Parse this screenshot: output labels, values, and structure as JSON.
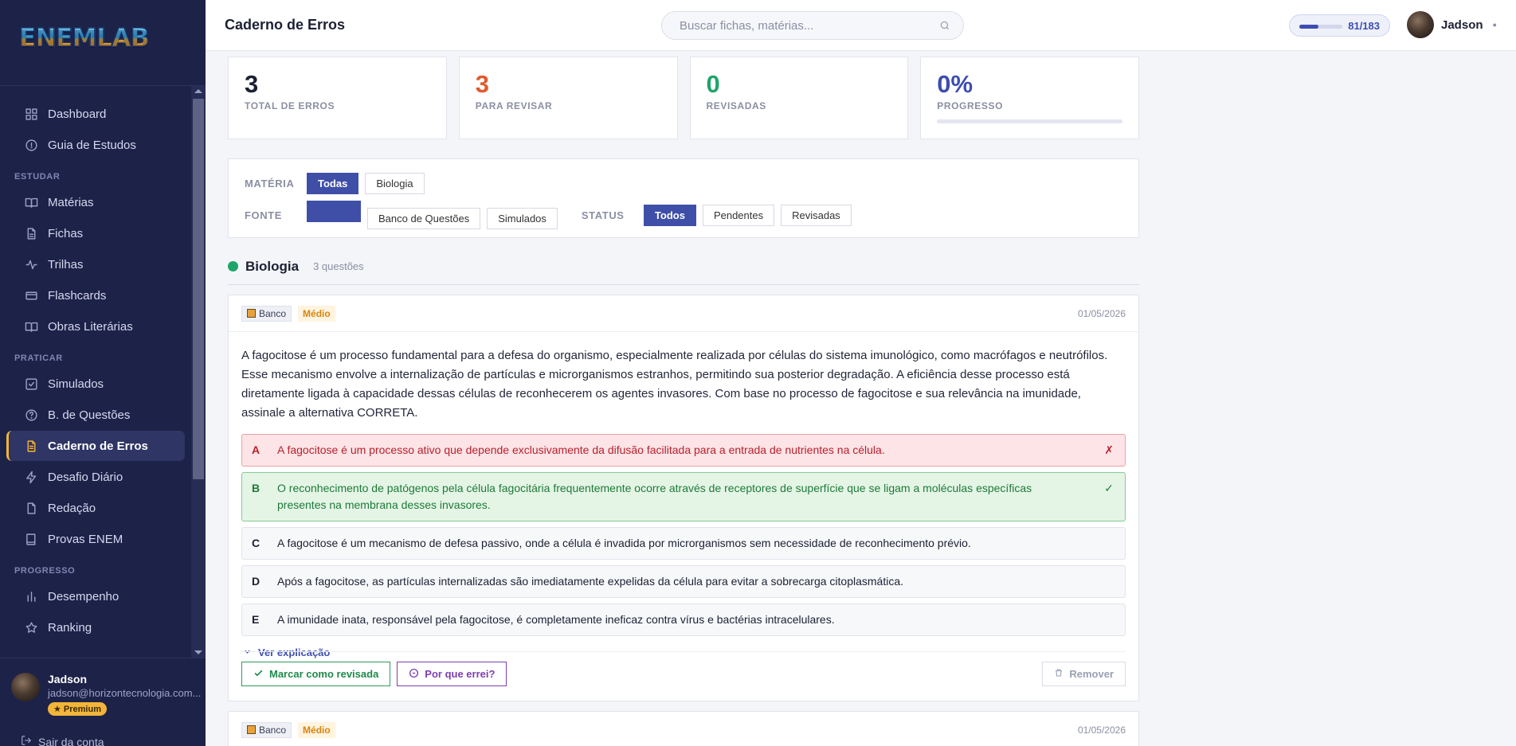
{
  "app": {
    "logo_text": "ENEMLAB"
  },
  "header": {
    "title": "Caderno de Erros",
    "search_placeholder": "Buscar fichas, matérias...",
    "progress_label": "81/183",
    "progress_fraction": 0.4426,
    "user_name": "Jadson"
  },
  "sidebar": {
    "top_items": [
      {
        "label": "Dashboard",
        "icon": "grid-icon"
      },
      {
        "label": "Guia de Estudos",
        "icon": "compass-icon"
      }
    ],
    "sections": [
      {
        "title": "ESTUDAR",
        "items": [
          {
            "label": "Matérias",
            "icon": "book-open-icon"
          },
          {
            "label": "Fichas",
            "icon": "file-text-icon"
          },
          {
            "label": "Trilhas",
            "icon": "activity-icon"
          },
          {
            "label": "Flashcards",
            "icon": "cards-icon"
          },
          {
            "label": "Obras Literárias",
            "icon": "book-icon"
          }
        ]
      },
      {
        "title": "PRATICAR",
        "items": [
          {
            "label": "Simulados",
            "icon": "check-square-icon"
          },
          {
            "label": "B. de Questões",
            "icon": "help-circle-icon"
          },
          {
            "label": "Caderno de Erros",
            "icon": "notebook-icon",
            "active": true
          },
          {
            "label": "Desafio Diário",
            "icon": "zap-icon"
          },
          {
            "label": "Redação",
            "icon": "edit-icon"
          },
          {
            "label": "Provas ENEM",
            "icon": "book-closed-icon"
          }
        ]
      },
      {
        "title": "PROGRESSO",
        "items": [
          {
            "label": "Desempenho",
            "icon": "bar-chart-icon"
          },
          {
            "label": "Ranking",
            "icon": "star-icon"
          }
        ]
      }
    ],
    "user": {
      "name": "Jadson",
      "email": "jadson@horizontecnologia.com...",
      "badge": "★ Premium",
      "logout_label": "Sair da conta"
    }
  },
  "stats": [
    {
      "value": "3",
      "label": "TOTAL DE ERROS",
      "color": "#1c2033"
    },
    {
      "value": "3",
      "label": "PARA REVISAR",
      "color": "#e25a2c"
    },
    {
      "value": "0",
      "label": "REVISADAS",
      "color": "#1fa46a"
    },
    {
      "value": "0%",
      "label": "PROGRESSO",
      "color": "#3d4db0",
      "progress": 0
    }
  ],
  "filters": {
    "materia_label": "MATÉRIA",
    "materia_options": [
      "Todas",
      "Biologia"
    ],
    "materia_selected": "Todas",
    "fonte_label": "FONTE",
    "fonte_options": [
      "",
      "Banco de Questões",
      "Simulados"
    ],
    "fonte_selected": "",
    "status_label": "STATUS",
    "status_options": [
      "Todos",
      "Pendentes",
      "Revisadas"
    ],
    "status_selected": "Todos"
  },
  "group": {
    "name": "Biologia",
    "count": "3 questões",
    "color": "#1fa46a"
  },
  "cards": [
    {
      "source": "Banco",
      "difficulty": "Médio",
      "date": "01/05/2026",
      "question": "A fagocitose é um processo fundamental para a defesa do organismo, especialmente realizada por células do sistema imunológico, como macrófagos e neutrófilos. Esse mecanismo envolve a internalização de partículas e microrganismos estranhos, permitindo sua posterior degradação. A eficiência desse processo está diretamente ligada à capacidade dessas células de reconhecerem os agentes invasores. Com base no processo de fagocitose e sua relevância na imunidade, assinale a alternativa CORRETA.",
      "options": [
        {
          "letter": "A",
          "text": "A fagocitose é um processo ativo que depende exclusivamente da difusão facilitada para a entrada de nutrientes na célula.",
          "state": "wrong",
          "mark": "✗"
        },
        {
          "letter": "B",
          "text": "O reconhecimento de patógenos pela célula fagocitária frequentemente ocorre através de receptores de superfície que se ligam a moléculas específicas presentes na membrana desses invasores.",
          "state": "right",
          "mark": "✓"
        },
        {
          "letter": "C",
          "text": "A fagocitose é um mecanismo de defesa passivo, onde a célula é invadida por microrganismos sem necessidade de reconhecimento prévio.",
          "state": "",
          "mark": ""
        },
        {
          "letter": "D",
          "text": "Após a fagocitose, as partículas internalizadas são imediatamente expelidas da célula para evitar a sobrecarga citoplasmática.",
          "state": "",
          "mark": ""
        },
        {
          "letter": "E",
          "text": "A imunidade inata, responsável pela fagocitose, é completamente ineficaz contra vírus e bactérias intracelulares.",
          "state": "",
          "mark": ""
        }
      ],
      "explain_label": "Ver explicação",
      "actions": {
        "review": "Marcar como revisada",
        "why": "Por que errei?",
        "remove": "Remover"
      }
    },
    {
      "source": "Banco",
      "difficulty": "Médio",
      "date": "01/05/2026"
    }
  ]
}
